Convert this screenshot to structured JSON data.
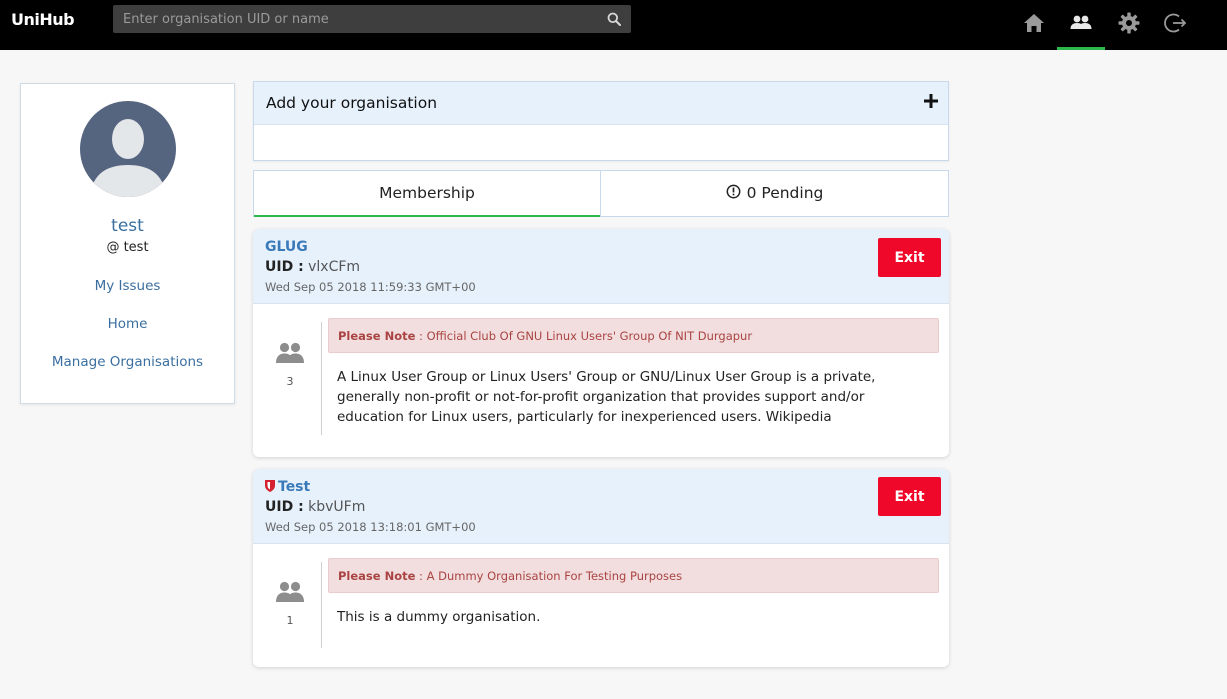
{
  "header": {
    "brand": "UniHub",
    "search_placeholder": "Enter organisation UID or name",
    "nav": [
      {
        "icon": "home-icon"
      },
      {
        "icon": "organisations-icon",
        "active": true
      },
      {
        "icon": "gear-icon"
      },
      {
        "icon": "logout-icon"
      }
    ],
    "accent_color": "#2db84b"
  },
  "profile": {
    "name": "test",
    "handle": "@ test",
    "links": [
      "My Issues",
      "Home",
      "Manage Organisations"
    ]
  },
  "add_org": {
    "title": "Add your organisation"
  },
  "tabs": {
    "membership": "Membership",
    "pending": "0 Pending"
  },
  "organisations": [
    {
      "name": "GLUG",
      "uid_label": "UID :",
      "uid": "vlxCFm",
      "date": "Wed Sep 05 2018 11:59:33 GMT+00",
      "exit_label": "Exit",
      "members": "3",
      "note_label": "Please Note",
      "note_text": " : Official Club Of GNU Linux Users' Group Of NIT Durgapur",
      "description": "A Linux User Group or Linux Users' Group or GNU/Linux User Group is a private, generally non-profit or not-for-profit organization that provides support and/or education for Linux users, particularly for inexperienced users. Wikipedia",
      "shield": false
    },
    {
      "name": "Test",
      "uid_label": "UID :",
      "uid": "kbvUFm",
      "date": "Wed Sep 05 2018 13:18:01 GMT+00",
      "exit_label": "Exit",
      "members": "1",
      "note_label": "Please Note",
      "note_text": " : A Dummy Organisation For Testing Purposes",
      "description": "This is a dummy organisation.",
      "shield": true
    }
  ]
}
